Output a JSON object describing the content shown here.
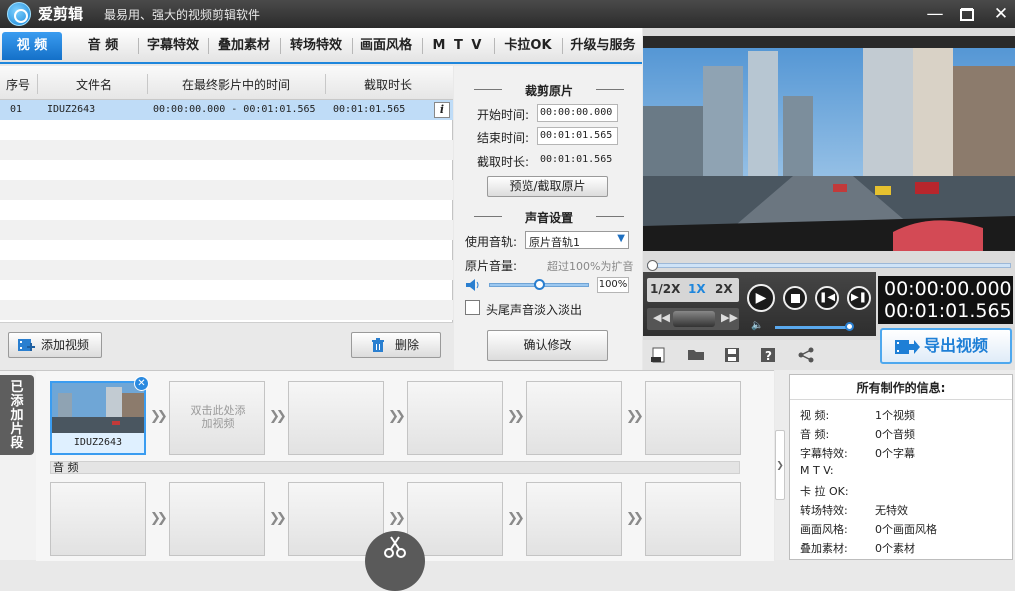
{
  "app": {
    "title": "爱剪辑",
    "slogan": "最易用、强大的视频剪辑软件"
  },
  "tabs": [
    {
      "label": "视  频",
      "active": true
    },
    {
      "label": "音  频"
    },
    {
      "label": "字幕特效"
    },
    {
      "label": "叠加素材"
    },
    {
      "label": "转场特效"
    },
    {
      "label": "画面风格"
    },
    {
      "label": "M T V"
    },
    {
      "label": "卡拉OK"
    },
    {
      "label": "升级与服务"
    }
  ],
  "list": {
    "headers": [
      "序号",
      "文件名",
      "在最终影片中的时间",
      "截取时长"
    ],
    "rows": [
      {
        "index": "01",
        "filename": "IDUZ2643",
        "span": "00:00:00.000 - 00:01:01.565",
        "duration": "00:01:01.565"
      }
    ],
    "add_button": "添加视频",
    "delete_button": "删除"
  },
  "clip_edit": {
    "title": "裁剪原片",
    "start_label": "开始时间:",
    "start_value": "00:00:00.000",
    "end_label": "结束时间:",
    "end_value": "00:01:01.565",
    "dur_label": "截取时长:",
    "dur_value": "00:01:01.565",
    "preview_button": "预览/截取原片"
  },
  "audio": {
    "title": "声音设置",
    "track_label": "使用音轨:",
    "track_value": "原片音轨1",
    "volume_label": "原片音量:",
    "volume_hint": "超过100%为扩音",
    "volume_value": "100%",
    "volume_fraction": 0.5,
    "fade_label": "头尾声音淡入淡出",
    "confirm_button": "确认修改"
  },
  "player": {
    "speeds": [
      "1/2X",
      "1X",
      "2X"
    ],
    "active_speed": "1X",
    "current_time": "00:00:00.000",
    "total_time": "00:01:01.565",
    "progress_fraction": 0,
    "volume_fraction": 0.95,
    "export_button": "导出视频"
  },
  "timeline": {
    "added_label": "已添加片段",
    "clip_name": "IDUZ2643",
    "empty_hint": "双击此处添加视频",
    "audio_label": "音 频"
  },
  "info": {
    "title": "所有制作的信息:",
    "items": [
      {
        "label": "视    频:",
        "value": "1个视频"
      },
      {
        "label": "音    频:",
        "value": "0个音频"
      },
      {
        "label": "字幕特效:",
        "value": "0个字幕"
      },
      {
        "label": "M  T  V:",
        "value": ""
      },
      {
        "label": "卡 拉 OK:",
        "value": ""
      },
      {
        "label": "转场特效:",
        "value": "无特效"
      },
      {
        "label": "画面风格:",
        "value": "0个画面风格"
      },
      {
        "label": "叠加素材:",
        "value": "0个素材"
      }
    ]
  },
  "colors": {
    "accent": "#1e86dc",
    "selected_row": "#bfdcf7"
  }
}
